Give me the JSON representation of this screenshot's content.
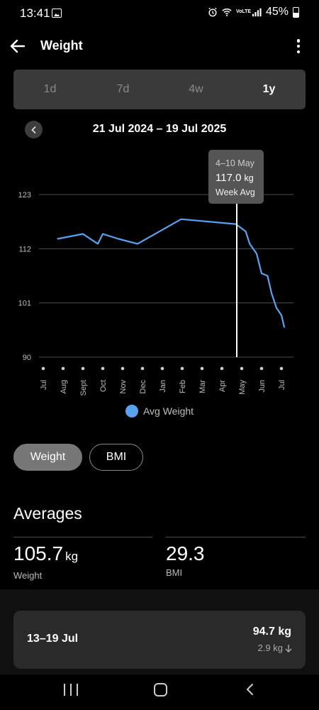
{
  "status": {
    "time": "13:41",
    "battery": "45%",
    "network": "VoLTE"
  },
  "app_bar": {
    "title": "Weight"
  },
  "range_tabs": [
    {
      "label": "1d",
      "active": false
    },
    {
      "label": "7d",
      "active": false
    },
    {
      "label": "4w",
      "active": false
    },
    {
      "label": "1y",
      "active": true
    }
  ],
  "date_range": "21 Jul 2024 – 19 Jul 2025",
  "tooltip": {
    "date": "4–10 May",
    "value": "117.0",
    "unit": "kg",
    "label": "Week Avg"
  },
  "chart_data": {
    "type": "line",
    "y_ticks": [
      "123",
      "112",
      "101",
      "90"
    ],
    "ylim": [
      90,
      123
    ],
    "x_tick_labels": [
      "Jul",
      "Aug",
      "Sept",
      "Oct",
      "Nov",
      "Dec",
      "Jan",
      "Feb",
      "Mar",
      "Apr",
      "May",
      "Jun",
      "Jul"
    ],
    "x_range": [
      0,
      12.2
    ],
    "grid": true,
    "legend": "bottom-center",
    "series": [
      {
        "name": "Avg Weight",
        "color": "#5aa2f0",
        "points": [
          [
            0.7,
            114.0
          ],
          [
            2.0,
            115.0
          ],
          [
            2.75,
            113.0
          ],
          [
            3.0,
            115.0
          ],
          [
            3.8,
            114.0
          ],
          [
            4.75,
            113.0
          ],
          [
            6.95,
            118.0
          ],
          [
            9.7,
            117.0
          ],
          [
            10.2,
            115.5
          ],
          [
            10.4,
            113.0
          ],
          [
            10.75,
            111.0
          ],
          [
            11.0,
            107.0
          ],
          [
            11.3,
            106.5
          ],
          [
            11.5,
            103.0
          ],
          [
            11.75,
            100.0
          ],
          [
            12.0,
            98.5
          ],
          [
            12.15,
            96.0
          ]
        ]
      }
    ],
    "highlight_x": 9.75
  },
  "metric_toggle": {
    "weight_label": "Weight",
    "bmi_label": "BMI"
  },
  "averages": {
    "title": "Averages",
    "weight_value": "105.7",
    "weight_unit": "kg",
    "weight_label": "Weight",
    "bmi_value": "29.3",
    "bmi_label": "BMI"
  },
  "week_card": {
    "range": "13–19 Jul",
    "weight": "94.7 kg",
    "change": "2.9 kg"
  }
}
